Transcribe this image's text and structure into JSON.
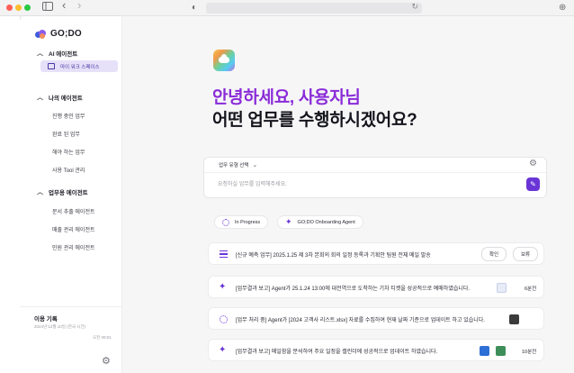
{
  "browser": {
    "sidebar_icon": "sidebar-toggle-icon",
    "back_icon": "‹",
    "forward_icon": "›",
    "shield_icon": "◐",
    "reload_icon": "↻",
    "download_icon": "⊕"
  },
  "app": {
    "brand": "GO;DO"
  },
  "sidebar": {
    "sections": [
      {
        "label": "AI 에이전트",
        "items": [
          "마이 워크 스페이스"
        ]
      },
      {
        "label": "나의 에이전트",
        "items": [
          "진행 중인 업무",
          "완료 된 업무",
          "해야 하는 업무",
          "사용 Tool 관리"
        ]
      },
      {
        "label": "업무용 에이전트",
        "items": [
          "문서 추출 에이전트",
          "매출 관리 에이전트",
          "민원 관리 에이전트"
        ]
      }
    ],
    "usage": {
      "title": "이용 기록",
      "left": "2024년 12월 10일 (한국 시간)",
      "right": "오전 09:01"
    }
  },
  "main": {
    "greeting_line1": "안녕하세요, 사용자님",
    "greeting_line2": "어떤 업무를 수행하시겠어요?",
    "prompt": {
      "task_select_label": "업무 유형 선택",
      "placeholder": "요청하실 업무를 입력해주세요."
    },
    "chips": [
      {
        "label": "In Progress",
        "icon": "spinner-icon"
      },
      {
        "label": "GO;DO Onboarding Agent",
        "icon": "sparkle-icon"
      }
    ],
    "rows": [
      {
        "icon": "list-icon",
        "text": "[신규 예측 업무] 2025.1.25 제 3차 본회의 회의 일정 등록과 기획안 팀원 전체 메일 발송",
        "confirm": "확인",
        "hold": "보류"
      },
      {
        "icon": "sparkle-icon",
        "text": "[업무결과 보고] Agent가 25.1.24 13:00에 대전역으로 도착하는 기차 티켓을 성공적으로 예매하였습니다.",
        "duration": "6분전"
      },
      {
        "icon": "spinner-icon",
        "text": "[업무 처리 중] Agent가 [2024 고객사 리스트.xlsx] 자료를 수집하여 현재 날짜 기준으로 업데이트 하고 있습니다."
      },
      {
        "icon": "sparkle-icon",
        "text": "[업무결과 보고] 메일함을 분석하여 주요 일정을 캘린더에 성공적으로 업데이트 하였습니다.",
        "duration": "10분전"
      }
    ]
  },
  "colors": {
    "accent": "#6a35d6",
    "greeting_purple": "#8a2bd8"
  }
}
